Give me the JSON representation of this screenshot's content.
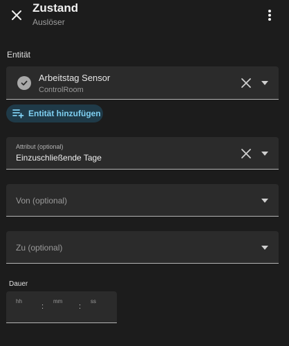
{
  "header": {
    "title": "Zustand",
    "subtitle": "Auslöser"
  },
  "entity_section": {
    "label": "Entität",
    "entity": {
      "name": "Arbeitstag Sensor",
      "area": "ControlRoom",
      "icon": "check-circle-icon"
    },
    "add_button_label": "Entität hinzufügen"
  },
  "attribute_field": {
    "label": "Attribut (optional)",
    "value": "Einzuschließende Tage"
  },
  "from_field": {
    "placeholder": "Von (optional)"
  },
  "to_field": {
    "placeholder": "Zu (optional)"
  },
  "duration": {
    "label": "Dauer",
    "hours_label": "hh",
    "minutes_label": "mm",
    "seconds_label": "ss",
    "separator": ":"
  },
  "colors": {
    "background": "#1c1c1c",
    "field_bg": "#2b2b2b",
    "accent": "#7fd0f2",
    "accent_bg": "#1f3a48"
  }
}
